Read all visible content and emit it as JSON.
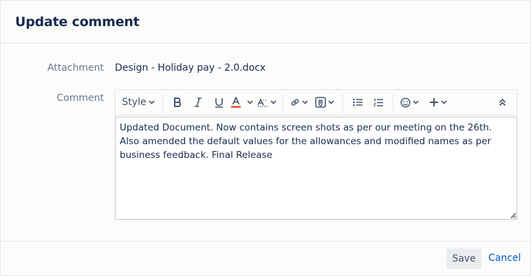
{
  "dialog": {
    "title": "Update comment"
  },
  "attachment": {
    "label": "Attachment",
    "value": "Design - Holiday pay - 2.0.docx"
  },
  "comment": {
    "label": "Comment",
    "text": "Updated Document. Now contains screen shots as per our meeting on the 26th.  Also amended the default values for the allowances and modified names as per business feedback.  Final Release"
  },
  "toolbar": {
    "style_label": "Style",
    "text_color": "#de350b",
    "icons": [
      "bold-icon",
      "italic-icon",
      "underline-icon",
      "text-color-icon",
      "more-formatting-icon",
      "link-icon",
      "attachment-icon",
      "bullet-list-icon",
      "numbered-list-icon",
      "emoji-icon",
      "insert-icon",
      "collapse-toolbar-icon"
    ]
  },
  "footer": {
    "save_label": "Save",
    "cancel_label": "Cancel"
  },
  "colors": {
    "link": "#0052cc",
    "text": "#172b4d",
    "muted": "#6b778c"
  }
}
